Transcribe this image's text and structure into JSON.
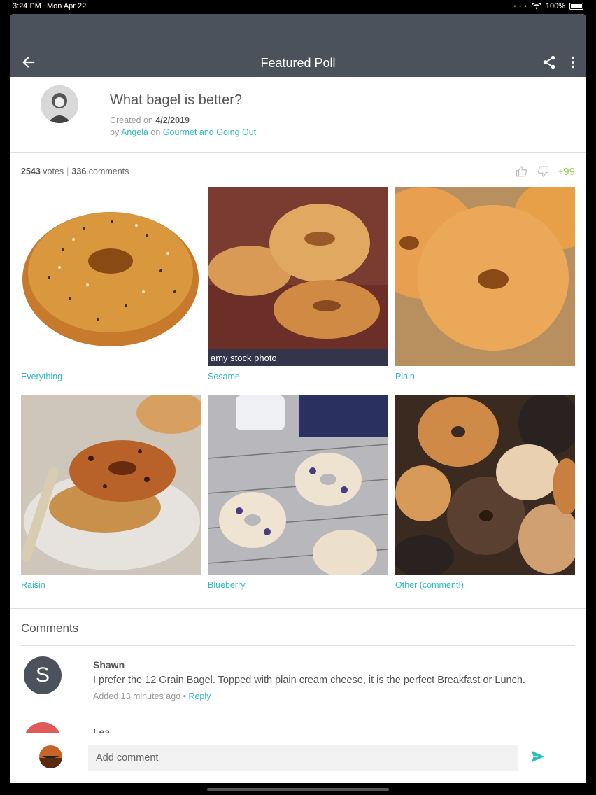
{
  "status_bar": {
    "time": "3:24 PM",
    "date": "Mon Apr 22",
    "battery": "100%"
  },
  "app_bar": {
    "title": "Featured Poll"
  },
  "poll": {
    "question": "What bagel is better?",
    "created_prefix": "Created on ",
    "created_date": "4/2/2019",
    "by_prefix": "by ",
    "author": "Angela",
    "on_text": " on ",
    "category": "Gourmet and Going Out",
    "votes_count": "2543",
    "votes_label": " votes",
    "comments_count": "336",
    "comments_label": " comments",
    "score": "+99",
    "options": [
      {
        "label": "Everything"
      },
      {
        "label": "Sesame",
        "watermark": "amy stock photo"
      },
      {
        "label": "Plain"
      },
      {
        "label": "Raisin"
      },
      {
        "label": "Blueberry"
      },
      {
        "label": "Other (comment!)"
      }
    ]
  },
  "comments": {
    "heading": "Comments",
    "items": [
      {
        "initial": "S",
        "name": "Shawn",
        "text": "I prefer the 12 Grain Bagel. Topped with plain cream cheese, it is the perfect Breakfast or Lunch.",
        "time": "Added 13 minutes ago",
        "dot": " • ",
        "reply": "Reply"
      },
      {
        "name": "Lea"
      }
    ]
  },
  "composer": {
    "placeholder": "Add comment"
  },
  "colors": {
    "accent": "#2fbcbc",
    "appbar": "#4b525c",
    "score": "#8fd14f"
  }
}
